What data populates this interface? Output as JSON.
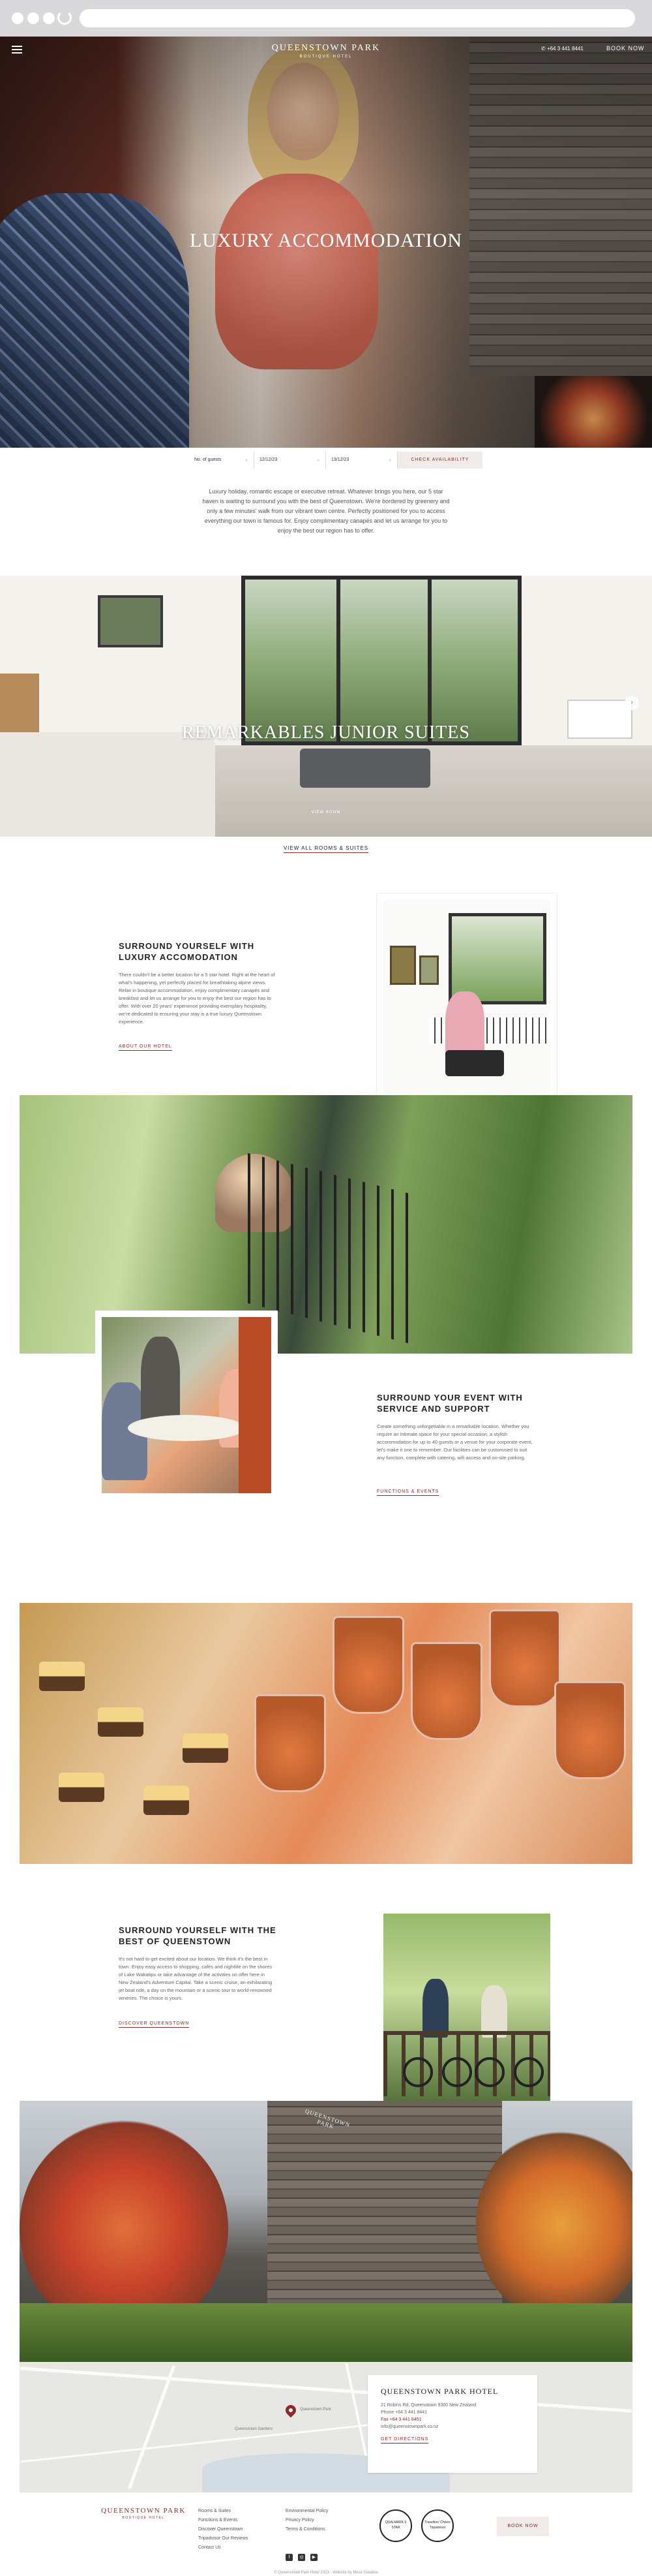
{
  "header": {
    "logo_name": "QUEENSTOWN PARK",
    "logo_sub": "BOUTIQUE HOTEL",
    "phone": "+64 3 441 8441",
    "book_now": "BOOK NOW"
  },
  "hero": {
    "title": "LUXURY ACCOMMODATION"
  },
  "booking": {
    "guests": "No. of guests",
    "check_in": "12/12/23",
    "check_out": "13/12/23",
    "check_availability": "CHECK AVAILABILITY"
  },
  "intro": {
    "text": "Luxury holiday, romantic escape or executive retreat. Whatever brings you here, our 5 star haven is waiting to surround you with the best of Queenstown. We're bordered by greenery and only a few minutes' walk from our vibrant town centre. Perfectly positioned for you to access everything our town is famous for. Enjoy complimentary canapés and let us arrange for you to enjoy the best our region has to offer."
  },
  "rooms_slider": {
    "slide_title": "REMARKABLES JUNIOR SUITES",
    "slide_view": "VIEW ROOM",
    "view_all": "VIEW ALL ROOMS & SUITES"
  },
  "sections": [
    {
      "title": "SURROUND YOURSELF WITH LUXURY ACCOMODATION",
      "body": "There couldn't be a better location for a 5 star hotel. Right at the heart of what's happening, yet perfectly placed for breathtaking alpine views. Relax in boutique accommodation, enjoy complimentary canapés and breakfast and let us arrange for you to enjoy the best our region has to offer. With over 20 years' experience providing exemplary hospitality, we're dedicated to ensuring your stay is a true luxury Queenstown experience.",
      "link": "ABOUT OUR HOTEL"
    },
    {
      "title": "SURROUND YOUR EVENT WITH SERVICE AND SUPPORT",
      "body": "Create something unforgettable in a remarkable location. Whether you require an intimate space for your special occasion, a stylish accommodation for up to 40 guests or a venue for your corporate event, let's make it one to remember. Our facilities can be customised to suit any function, complete with catering, wifi access and on-site parking.",
      "link": "FUNCTIONS & EVENTS"
    },
    {
      "title": "SURROUND YOURSELF WITH THE BEST OF QUEENSTOWN",
      "body": "It's not hard to get excited about our location. We think it's the best in town. Enjoy easy access to shopping, cafés and nightlife on the shores of Lake Wakatipu or take advantage of the activities on offer here in New Zealand's Adventure Capital. Take a scenic cruise, an exhilarating jet boat ride, a day on the mountain or a scenic tour to world-renowned wineries. The choice is yours.",
      "link": "DISCOVER QUEENSTOWN"
    }
  ],
  "exterior_sign": "QUEENSTOWN PARK",
  "map": {
    "labels": [
      "Queenstown Park",
      "Queenstown Gardens"
    ],
    "card_title": "QUEENSTOWN PARK HOTEL",
    "address": "21 Robins Rd, Queenstown 9300 New Zealand",
    "phone": "Phone +64 3 441 8441",
    "fax": "Fax +64 3 441 8451",
    "email": "info@queenstownpark.co.nz",
    "directions": "GET DIRECTIONS"
  },
  "footer": {
    "logo_name": "QUEENSTOWN PARK",
    "logo_sub": "BOUTIQUE HOTEL",
    "col1": [
      "Rooms & Suites",
      "Functions & Events",
      "Discover Queenstown",
      "Tripadvisor Our Reviews",
      "Contact Us"
    ],
    "col2": [
      "Environmental Policy",
      "Privacy Policy",
      "Terms & Conditions"
    ],
    "badge1": "QUALMARK 5 STAR",
    "badge2": "Travellers' Choice Tripadvisor",
    "book_now": "BOOK NOW",
    "copyright": "© Queenstown Park Hotel 2023 · Website by Mess Creative"
  },
  "colors": {
    "accent": "#8a2a2a",
    "button_bg": "#f1ecea"
  }
}
